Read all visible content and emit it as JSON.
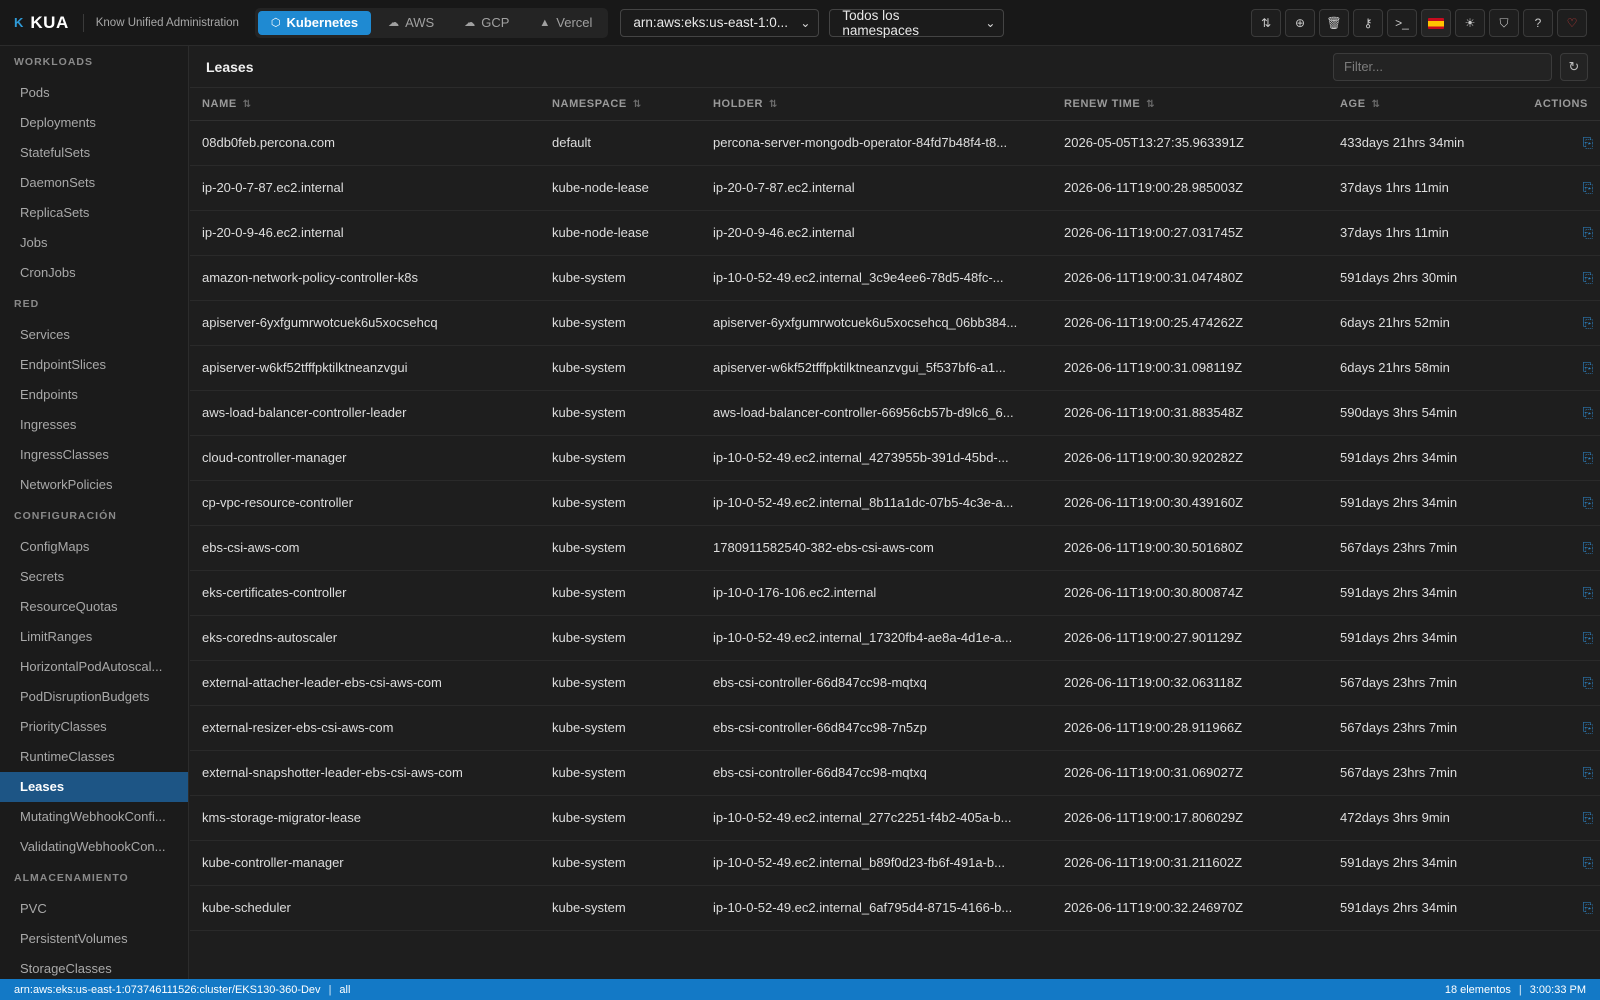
{
  "app": {
    "logo_mark": "K",
    "name": "KUA",
    "subtitle": "Know Unified Administration"
  },
  "providers": [
    {
      "label": "Kubernetes",
      "icon": "cube-icon",
      "active": true
    },
    {
      "label": "AWS",
      "icon": "cloud-icon",
      "active": false
    },
    {
      "label": "GCP",
      "icon": "cloud-upload-icon",
      "active": false
    },
    {
      "label": "Vercel",
      "icon": "triangle-icon",
      "active": false
    }
  ],
  "cluster_select": {
    "value": "arn:aws:eks:us-east-1:0..."
  },
  "namespace_select": {
    "value": "Todos los namespaces"
  },
  "toolbar_icons": [
    "switch-context-icon",
    "add-resource-icon",
    "trash-icon",
    "key-icon",
    "terminal-icon",
    "spain-flag-icon",
    "theme-sun-icon",
    "shield-icon",
    "help-icon",
    "heart-icon"
  ],
  "sidebar": {
    "sections": [
      {
        "title": "WORKLOADS",
        "items": [
          "Pods",
          "Deployments",
          "StatefulSets",
          "DaemonSets",
          "ReplicaSets",
          "Jobs",
          "CronJobs"
        ]
      },
      {
        "title": "RED",
        "items": [
          "Services",
          "EndpointSlices",
          "Endpoints",
          "Ingresses",
          "IngressClasses",
          "NetworkPolicies"
        ]
      },
      {
        "title": "CONFIGURACIÓN",
        "items": [
          "ConfigMaps",
          "Secrets",
          "ResourceQuotas",
          "LimitRanges",
          "HorizontalPodAutoscal...",
          "PodDisruptionBudgets",
          "PriorityClasses",
          "RuntimeClasses",
          "Leases",
          "MutatingWebhookConfi...",
          "ValidatingWebhookCon..."
        ]
      },
      {
        "title": "ALMACENAMIENTO",
        "items": [
          "PVC",
          "PersistentVolumes",
          "StorageClasses"
        ]
      }
    ],
    "active_item": "Leases"
  },
  "main": {
    "title": "Leases",
    "filter_placeholder": "Filter...",
    "columns": [
      "NAME",
      "NAMESPACE",
      "HOLDER",
      "RENEW TIME",
      "AGE",
      "ACTIONS"
    ],
    "rows": [
      [
        "08db0feb.percona.com",
        "default",
        "percona-server-mongodb-operator-84fd7b48f4-t8...",
        "2026-05-05T13:27:35.963391Z",
        "433days 21hrs 34min"
      ],
      [
        "ip-20-0-7-87.ec2.internal",
        "kube-node-lease",
        "ip-20-0-7-87.ec2.internal",
        "2026-06-11T19:00:28.985003Z",
        "37days 1hrs 11min"
      ],
      [
        "ip-20-0-9-46.ec2.internal",
        "kube-node-lease",
        "ip-20-0-9-46.ec2.internal",
        "2026-06-11T19:00:27.031745Z",
        "37days 1hrs 11min"
      ],
      [
        "amazon-network-policy-controller-k8s",
        "kube-system",
        "ip-10-0-52-49.ec2.internal_3c9e4ee6-78d5-48fc-...",
        "2026-06-11T19:00:31.047480Z",
        "591days 2hrs 30min"
      ],
      [
        "apiserver-6yxfgumrwotcuek6u5xocsehcq",
        "kube-system",
        "apiserver-6yxfgumrwotcuek6u5xocsehcq_06bb384...",
        "2026-06-11T19:00:25.474262Z",
        "6days 21hrs 52min"
      ],
      [
        "apiserver-w6kf52tfffpktilktneanzvgui",
        "kube-system",
        "apiserver-w6kf52tfffpktilktneanzvgui_5f537bf6-a1...",
        "2026-06-11T19:00:31.098119Z",
        "6days 21hrs 58min"
      ],
      [
        "aws-load-balancer-controller-leader",
        "kube-system",
        "aws-load-balancer-controller-66956cb57b-d9lc6_6...",
        "2026-06-11T19:00:31.883548Z",
        "590days 3hrs 54min"
      ],
      [
        "cloud-controller-manager",
        "kube-system",
        "ip-10-0-52-49.ec2.internal_4273955b-391d-45bd-...",
        "2026-06-11T19:00:30.920282Z",
        "591days 2hrs 34min"
      ],
      [
        "cp-vpc-resource-controller",
        "kube-system",
        "ip-10-0-52-49.ec2.internal_8b11a1dc-07b5-4c3e-a...",
        "2026-06-11T19:00:30.439160Z",
        "591days 2hrs 34min"
      ],
      [
        "ebs-csi-aws-com",
        "kube-system",
        "1780911582540-382-ebs-csi-aws-com",
        "2026-06-11T19:00:30.501680Z",
        "567days 23hrs 7min"
      ],
      [
        "eks-certificates-controller",
        "kube-system",
        "ip-10-0-176-106.ec2.internal",
        "2026-06-11T19:00:30.800874Z",
        "591days 2hrs 34min"
      ],
      [
        "eks-coredns-autoscaler",
        "kube-system",
        "ip-10-0-52-49.ec2.internal_17320fb4-ae8a-4d1e-a...",
        "2026-06-11T19:00:27.901129Z",
        "591days 2hrs 34min"
      ],
      [
        "external-attacher-leader-ebs-csi-aws-com",
        "kube-system",
        "ebs-csi-controller-66d847cc98-mqtxq",
        "2026-06-11T19:00:32.063118Z",
        "567days 23hrs 7min"
      ],
      [
        "external-resizer-ebs-csi-aws-com",
        "kube-system",
        "ebs-csi-controller-66d847cc98-7n5zp",
        "2026-06-11T19:00:28.911966Z",
        "567days 23hrs 7min"
      ],
      [
        "external-snapshotter-leader-ebs-csi-aws-com",
        "kube-system",
        "ebs-csi-controller-66d847cc98-mqtxq",
        "2026-06-11T19:00:31.069027Z",
        "567days 23hrs 7min"
      ],
      [
        "kms-storage-migrator-lease",
        "kube-system",
        "ip-10-0-52-49.ec2.internal_277c2251-f4b2-405a-b...",
        "2026-06-11T19:00:17.806029Z",
        "472days 3hrs 9min"
      ],
      [
        "kube-controller-manager",
        "kube-system",
        "ip-10-0-52-49.ec2.internal_b89f0d23-fb6f-491a-b...",
        "2026-06-11T19:00:31.211602Z",
        "591days 2hrs 34min"
      ],
      [
        "kube-scheduler",
        "kube-system",
        "ip-10-0-52-49.ec2.internal_6af795d4-8715-4166-b...",
        "2026-06-11T19:00:32.246970Z",
        "591days 2hrs 34min"
      ]
    ]
  },
  "statusbar": {
    "cluster": "arn:aws:eks:us-east-1:073746111526:cluster/EKS130-360-Dev",
    "namespace": "all",
    "count": "18 elementos",
    "time": "3:00:33 PM"
  },
  "colors": {
    "accent": "#1f8ad2",
    "active_sidebar": "#1d5585",
    "statusbar": "#1379c6",
    "heart": "#e0413d"
  }
}
